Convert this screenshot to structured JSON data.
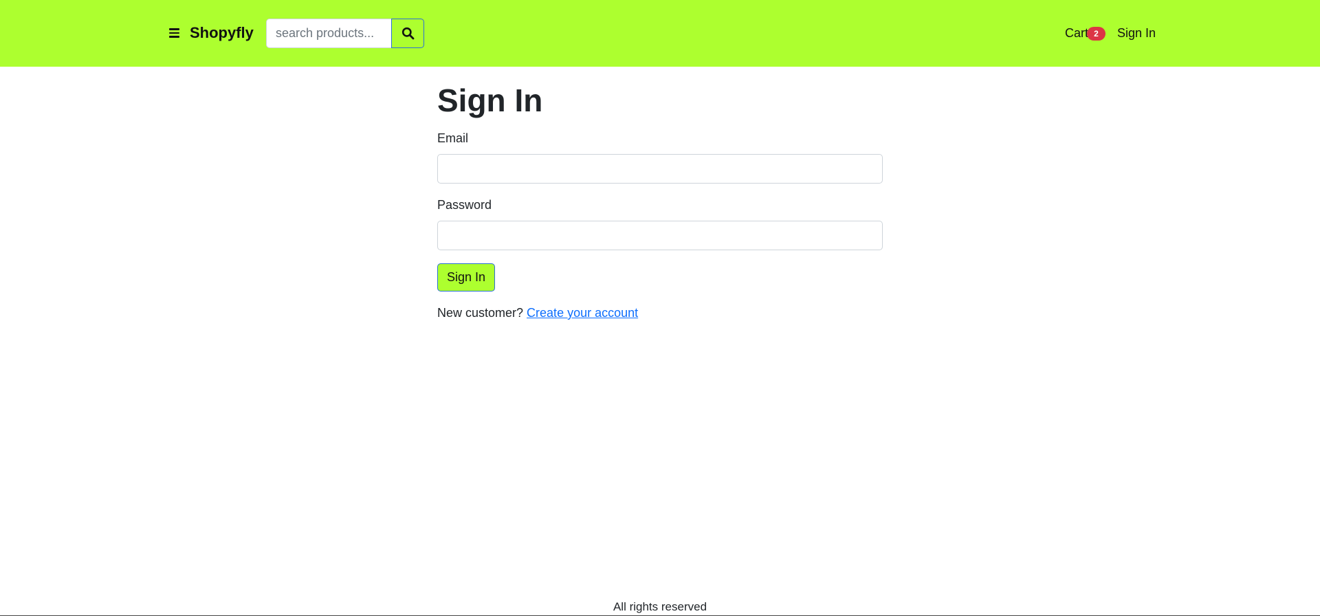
{
  "header": {
    "brand": "Shopyfly",
    "search": {
      "placeholder": "search products...",
      "value": ""
    },
    "cart_label": "Cart",
    "cart_count": "2",
    "signin_label": "Sign In",
    "background_color": "#adff2f"
  },
  "icons": {
    "menu": "hamburger-menu-icon",
    "search": "search-icon"
  },
  "form": {
    "title": "Sign In",
    "email_label": "Email",
    "email_value": "",
    "password_label": "Password",
    "password_value": "",
    "submit_label": "Sign In",
    "new_customer_text": "New customer? ",
    "create_account_link": "Create your account"
  },
  "footer": {
    "text": "All rights reserved"
  },
  "colors": {
    "accent": "#adff2f",
    "badge": "#dc3545",
    "link": "#0d6efd"
  }
}
